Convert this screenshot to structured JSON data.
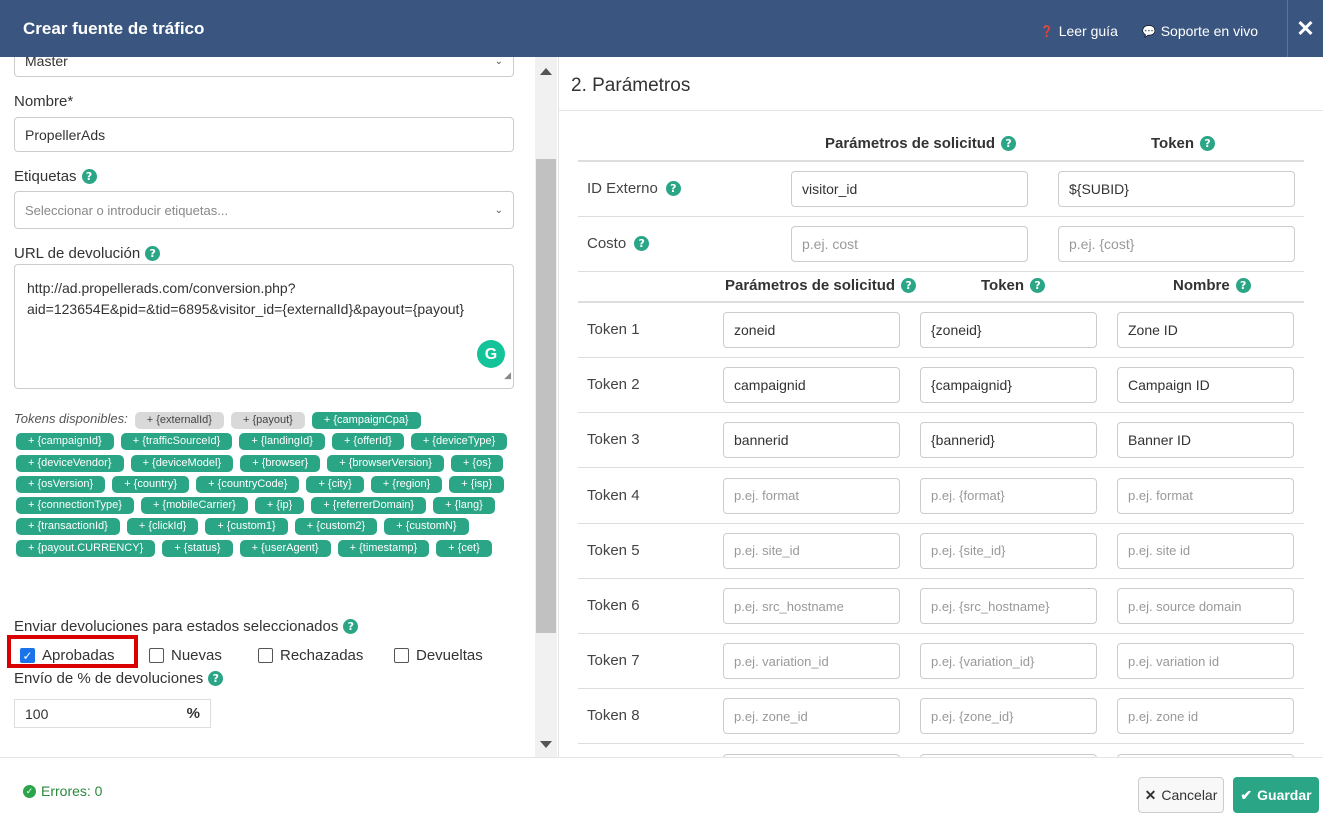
{
  "header": {
    "title": "Crear fuente de tráfico",
    "guide": "Leer guía",
    "support": "Soporte en vivo",
    "close": "✕"
  },
  "left": {
    "select_partial": "Master",
    "name_label": "Nombre*",
    "name_value": "PropellerAds",
    "tags_label": "Etiquetas",
    "tags_placeholder": "Seleccionar o introducir etiquetas...",
    "url_label": "URL de devolución",
    "url_line1": "http://ad.propellerads.com/conversion.php?",
    "url_line2": "aid=123654E&pid=&tid=6895&visitor_id={externalId}&payout={payout}",
    "tokens_label": "Tokens disponibles:",
    "tokens": [
      {
        "t": "+ {externalId}",
        "used": true
      },
      {
        "t": "+ {payout}",
        "used": true
      },
      {
        "t": "+ {campaignCpa}",
        "used": false
      },
      {
        "t": "+ {campaignId}",
        "used": false
      },
      {
        "t": "+ {trafficSourceId}",
        "used": false
      },
      {
        "t": "+ {landingId}",
        "used": false
      },
      {
        "t": "+ {offerId}",
        "used": false
      },
      {
        "t": "+ {deviceType}",
        "used": false
      },
      {
        "t": "+ {deviceVendor}",
        "used": false
      },
      {
        "t": "+ {deviceModel}",
        "used": false
      },
      {
        "t": "+ {browser}",
        "used": false
      },
      {
        "t": "+ {browserVersion}",
        "used": false
      },
      {
        "t": "+ {os}",
        "used": false
      },
      {
        "t": "+ {osVersion}",
        "used": false
      },
      {
        "t": "+ {country}",
        "used": false
      },
      {
        "t": "+ {countryCode}",
        "used": false
      },
      {
        "t": "+ {city}",
        "used": false
      },
      {
        "t": "+ {region}",
        "used": false
      },
      {
        "t": "+ {isp}",
        "used": false
      },
      {
        "t": "+ {connectionType}",
        "used": false
      },
      {
        "t": "+ {mobileCarrier}",
        "used": false
      },
      {
        "t": "+ {ip}",
        "used": false
      },
      {
        "t": "+ {referrerDomain}",
        "used": false
      },
      {
        "t": "+ {lang}",
        "used": false
      },
      {
        "t": "+ {transactionId}",
        "used": false
      },
      {
        "t": "+ {clickId}",
        "used": false
      },
      {
        "t": "+ {custom1}",
        "used": false
      },
      {
        "t": "+ {custom2}",
        "used": false
      },
      {
        "t": "+ {customN}",
        "used": false
      },
      {
        "t": "+ {payout.CURRENCY}",
        "used": false
      },
      {
        "t": "+ {status}",
        "used": false
      },
      {
        "t": "+ {userAgent}",
        "used": false
      },
      {
        "t": "+ {timestamp}",
        "used": false
      },
      {
        "t": "+ {cet}",
        "used": false
      }
    ],
    "status_label": "Enviar devoluciones para estados seleccionados",
    "statuses": [
      {
        "label": "Aprobadas",
        "checked": true
      },
      {
        "label": "Nuevas",
        "checked": false
      },
      {
        "label": "Rechazadas",
        "checked": false
      },
      {
        "label": "Devueltas",
        "checked": false
      }
    ],
    "pct_label": "Envío de % de devoluciones",
    "pct_value": "100",
    "pct_sign": "%"
  },
  "right": {
    "title": "2. Parámetros",
    "top_headers": {
      "param": "Parámetros de solicitud",
      "token": "Token"
    },
    "top_rows": [
      {
        "label": "ID Externo",
        "param": "visitor_id",
        "param_ph": false,
        "token": "${SUBID}",
        "token_ph": false,
        "help": true
      },
      {
        "label": "Costo",
        "param": "p.ej. cost",
        "param_ph": true,
        "token": "p.ej. {cost}",
        "token_ph": true,
        "help": true
      }
    ],
    "tok_headers": {
      "param": "Parámetros de solicitud",
      "token": "Token",
      "name": "Nombre"
    },
    "tok_rows": [
      {
        "label": "Token 1",
        "param": "zoneid",
        "token": "{zoneid}",
        "name": "Zone ID",
        "ph": false
      },
      {
        "label": "Token 2",
        "param": "campaignid",
        "token": "{campaignid}",
        "name": "Campaign ID",
        "ph": false
      },
      {
        "label": "Token 3",
        "param": "bannerid",
        "token": "{bannerid}",
        "name": "Banner ID",
        "ph": false
      },
      {
        "label": "Token 4",
        "param": "p.ej. format",
        "token": "p.ej. {format}",
        "name": "p.ej. format",
        "ph": true
      },
      {
        "label": "Token 5",
        "param": "p.ej. site_id",
        "token": "p.ej. {site_id}",
        "name": "p.ej. site id",
        "ph": true
      },
      {
        "label": "Token 6",
        "param": "p.ej. src_hostname",
        "token": "p.ej.  {src_hostname}",
        "name": "p.ej. source domain",
        "ph": true
      },
      {
        "label": "Token 7",
        "param": "p.ej. variation_id",
        "token": "p.ej. {variation_id}",
        "name": "p.ej. variation id",
        "ph": true
      },
      {
        "label": "Token 8",
        "param": "p.ej. zone_id",
        "token": "p.ej. {zone_id}",
        "name": "p.ej. zone id",
        "ph": true
      }
    ]
  },
  "footer": {
    "errors": "Errores: 0",
    "cancel": "Cancelar",
    "save": "Guardar"
  },
  "colors": {
    "header": "#3a5680",
    "accent": "#2aa585",
    "highlight": "#d90000"
  }
}
